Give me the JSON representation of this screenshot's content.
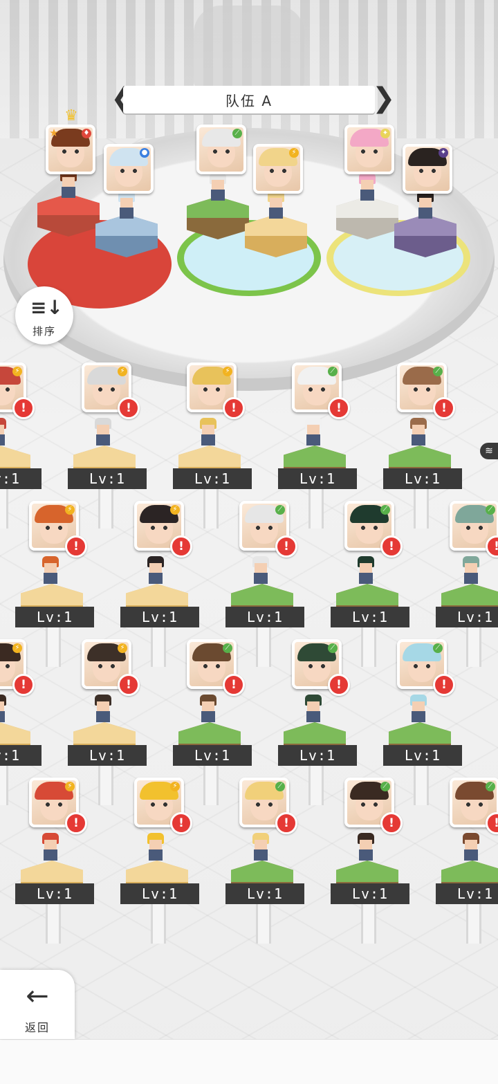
{
  "team": {
    "title": "队伍 A",
    "prev_arrow": "❮",
    "next_arrow": "❯"
  },
  "buttons": {
    "sort_label": "排序",
    "sort_icon": "≡↓",
    "back_label": "返回",
    "back_icon": "←"
  },
  "alert_symbol": "!",
  "colors": {
    "red": "#d9453a",
    "blue": "#7fa3c7",
    "green": "#6aa84f",
    "yellow": "#f0c36d",
    "grey": "#d8d4cc",
    "purple": "#8b7aa6",
    "alert": "#e53935",
    "label_bg": "#3a3a3a"
  },
  "team_members": [
    {
      "slot": 1,
      "element": "fire",
      "element_icon": "♦",
      "leader": true,
      "leader_icon": "♛",
      "rank_icon": "★",
      "hair": "#7a3b1e"
    },
    {
      "slot": 2,
      "element": "water",
      "element_icon": "●",
      "leader": false,
      "hair": "#cfe3f0"
    },
    {
      "slot": 3,
      "element": "nature",
      "element_icon": "⟋",
      "leader": false,
      "hair": "#e8e8e8"
    },
    {
      "slot": 4,
      "element": "lightning",
      "element_icon": "⚡",
      "leader": false,
      "hair": "#f1d48a"
    },
    {
      "slot": 5,
      "element": "light",
      "element_icon": "✦",
      "leader": false,
      "hair": "#f3a8c6"
    },
    {
      "slot": 6,
      "element": "dark",
      "element_icon": "✦",
      "leader": false,
      "hair": "#2a2320"
    }
  ],
  "roster": [
    {
      "row": 1,
      "level_label": "Lv:1",
      "items": [
        {
          "element": "lightning",
          "hair": "#c6473b",
          "platform": "yellow"
        },
        {
          "element": "lightning",
          "hair": "#d9d9d9",
          "platform": "yellow"
        },
        {
          "element": "lightning",
          "hair": "#e8c25b",
          "platform": "yellow"
        },
        {
          "element": "nature",
          "hair": "#f1f1f1",
          "platform": "green"
        },
        {
          "element": "nature",
          "hair": "#9a6b4a",
          "platform": "green"
        }
      ]
    },
    {
      "row": 2,
      "level_label": "Lv:1",
      "items": [
        {
          "element": "lightning",
          "hair": "#d7642c",
          "platform": "yellow"
        },
        {
          "element": "lightning",
          "hair": "#2b2424",
          "platform": "yellow"
        },
        {
          "element": "nature",
          "hair": "#e6e6e6",
          "platform": "green"
        },
        {
          "element": "nature",
          "hair": "#1f3b2e",
          "platform": "green"
        },
        {
          "element": "nature",
          "hair": "#7fa79a",
          "platform": "green"
        }
      ]
    },
    {
      "row": 3,
      "level_label": "Lv:1",
      "items": [
        {
          "element": "lightning",
          "hair": "#3b2a22",
          "platform": "yellow"
        },
        {
          "element": "lightning",
          "hair": "#3d3028",
          "platform": "yellow"
        },
        {
          "element": "nature",
          "hair": "#6b4a30",
          "platform": "green"
        },
        {
          "element": "nature",
          "hair": "#2f4a36",
          "platform": "green"
        },
        {
          "element": "nature",
          "hair": "#a6d8e6",
          "platform": "green"
        }
      ]
    },
    {
      "row": 4,
      "level_label": "Lv:1",
      "items": [
        {
          "element": "lightning",
          "hair": "#d74a36",
          "platform": "yellow"
        },
        {
          "element": "lightning",
          "hair": "#f2c12e",
          "platform": "yellow"
        },
        {
          "element": "nature",
          "hair": "#f1d07a",
          "platform": "green"
        },
        {
          "element": "nature",
          "hair": "#3a2a22",
          "platform": "green"
        },
        {
          "element": "nature",
          "hair": "#7a4a30",
          "platform": "green"
        }
      ]
    }
  ],
  "edge_tab_icon": "≋"
}
